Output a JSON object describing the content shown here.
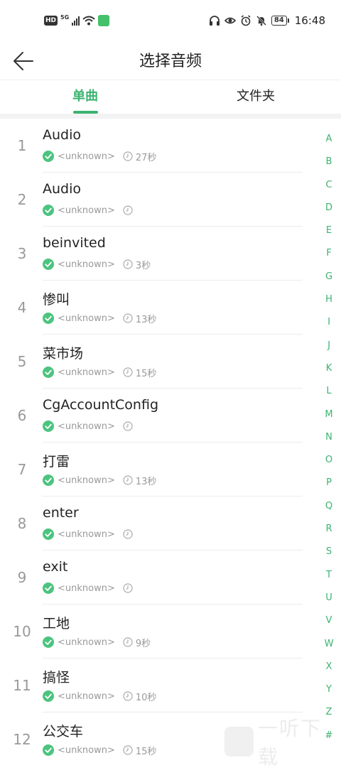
{
  "status_bar": {
    "hd": "HD",
    "network": "5G",
    "battery": "84",
    "time": "16:48"
  },
  "header": {
    "title": "选择音频"
  },
  "tabs": [
    {
      "label": "单曲",
      "active": true
    },
    {
      "label": "文件夹",
      "active": false
    }
  ],
  "accent_color": "#3cb371",
  "tracks": [
    {
      "index": "1",
      "title": "Audio",
      "artist": "<unknown>",
      "duration": "27秒"
    },
    {
      "index": "2",
      "title": "Audio",
      "artist": "<unknown>",
      "duration": ""
    },
    {
      "index": "3",
      "title": "beinvited",
      "artist": "<unknown>",
      "duration": "3秒"
    },
    {
      "index": "4",
      "title": "惨叫",
      "artist": "<unknown>",
      "duration": "13秒"
    },
    {
      "index": "5",
      "title": "菜市场",
      "artist": "<unknown>",
      "duration": "15秒"
    },
    {
      "index": "6",
      "title": "CgAccountConfig",
      "artist": "<unknown>",
      "duration": ""
    },
    {
      "index": "7",
      "title": "打雷",
      "artist": "<unknown>",
      "duration": "13秒"
    },
    {
      "index": "8",
      "title": "enter",
      "artist": "<unknown>",
      "duration": ""
    },
    {
      "index": "9",
      "title": "exit",
      "artist": "<unknown>",
      "duration": ""
    },
    {
      "index": "10",
      "title": "工地",
      "artist": "<unknown>",
      "duration": "9秒"
    },
    {
      "index": "11",
      "title": "搞怪",
      "artist": "<unknown>",
      "duration": "10秒"
    },
    {
      "index": "12",
      "title": "公交车",
      "artist": "<unknown>",
      "duration": "15秒"
    }
  ],
  "index_letters": [
    "A",
    "B",
    "C",
    "D",
    "E",
    "F",
    "G",
    "H",
    "I",
    "J",
    "K",
    "L",
    "M",
    "N",
    "O",
    "P",
    "Q",
    "R",
    "S",
    "T",
    "U",
    "V",
    "W",
    "X",
    "Y",
    "Z",
    "#"
  ],
  "watermark": {
    "text": "一听下载"
  }
}
